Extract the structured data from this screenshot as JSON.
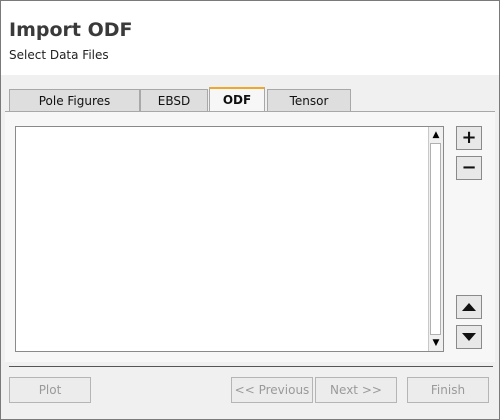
{
  "header": {
    "title": "Import ODF",
    "subtitle": "Select Data Files"
  },
  "tabs": [
    {
      "label": "Pole Figures",
      "active": false
    },
    {
      "label": "EBSD",
      "active": false
    },
    {
      "label": "ODF",
      "active": true
    },
    {
      "label": "Tensor",
      "active": false
    }
  ],
  "file_list": {
    "items": [],
    "scroll_up_icon": "▲",
    "scroll_down_icon": "▼"
  },
  "side_buttons": {
    "add_icon": "+",
    "remove_icon": "−",
    "move_up_icon": "up-arrow-icon",
    "move_down_icon": "down-arrow-icon"
  },
  "footer": {
    "plot": "Plot",
    "previous": "<< Previous",
    "next": "Next >>",
    "finish": "Finish"
  },
  "colors": {
    "active_tab_accent": "#f0a82c",
    "disabled_text": "#9a9a9a"
  }
}
